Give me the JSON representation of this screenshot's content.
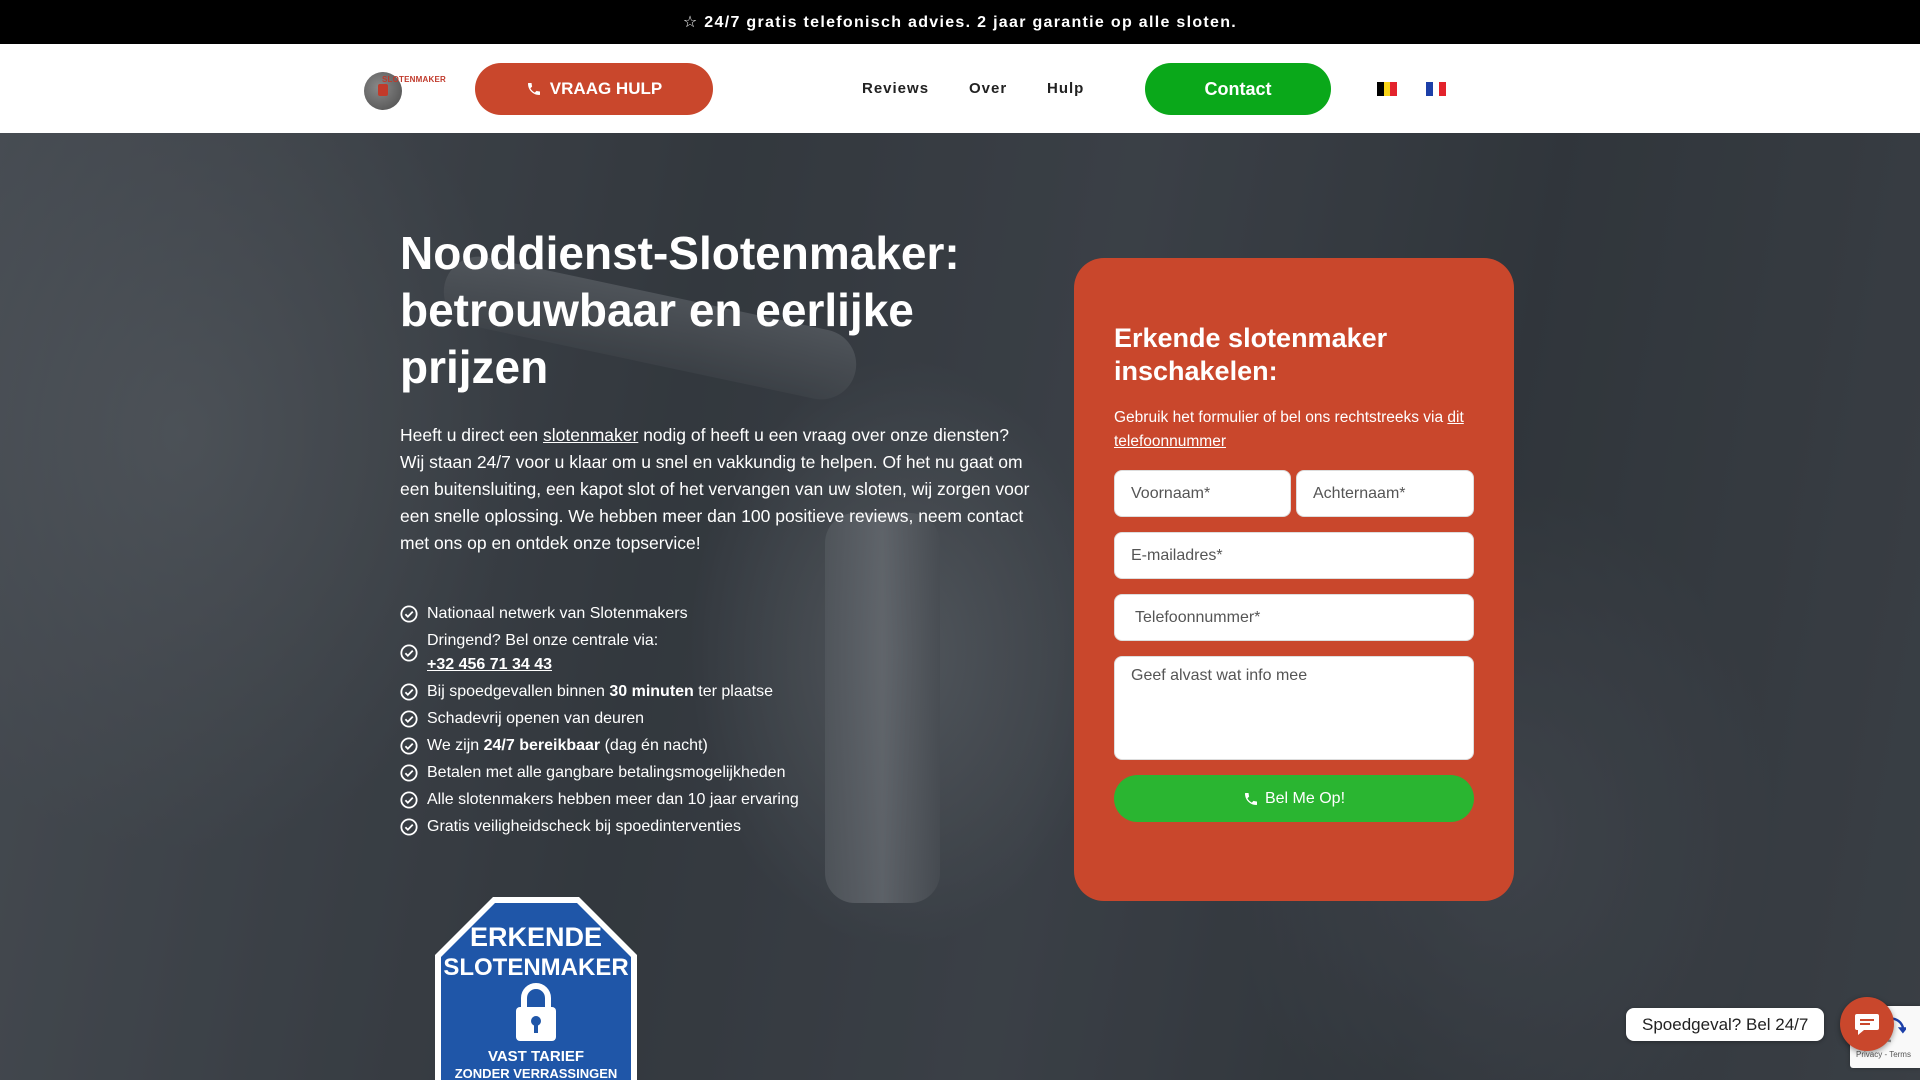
{
  "topbar": {
    "text": "☆ 24/7 gratis telefonisch advies. 2 jaar garantie op alle sloten."
  },
  "header": {
    "logo_text": "SLOTENMAKER",
    "help_button": "VRAAG HULP",
    "nav": [
      "Reviews",
      "Over",
      "Hulp"
    ],
    "contact_button": "Contact",
    "languages": [
      "nl-be-flag-icon",
      "fr-flag-icon"
    ]
  },
  "hero": {
    "title": "Nooddienst-Slotenmaker: betrouwbaar en eerlijke prijzen",
    "intro_before": "Heeft u direct een ",
    "intro_link": "slotenmaker",
    "intro_after": " nodig of heeft u een vraag over onze diensten? Wij staan 24/7 voor u klaar om u snel en vakkundig te helpen. Of het nu gaat om een buitensluiting, een kapot slot of het vervangen van uw sloten, wij zorgen voor een snelle oplossing. We hebben meer dan 100 positieve reviews, neem contact met ons op en ontdek onze topservice!",
    "features": {
      "f1": "Nationaal netwerk van Slotenmakers",
      "f2_text": "Dringend? Bel onze centrale via:",
      "f2_phone": "+32 456 71 34 43",
      "f3_pre": "Bij spoedgevallen binnen ",
      "f3_bold": "30 minuten",
      "f3_post": " ter plaatse",
      "f4": "Schadevrij openen van deuren",
      "f5_pre": "We zijn ",
      "f5_bold": "24/7 bereikbaar",
      "f5_post": " (dag én nacht)",
      "f6": "Betalen met alle gangbare betalingsmogelijkheden",
      "f7": "Alle slotenmakers hebben meer dan 10 jaar ervaring",
      "f8": "Gratis veiligheidscheck bij spoedinterventies"
    },
    "badge": {
      "line1": "ERKENDE",
      "line2": "SLOTENMAKER",
      "line3": "VAST TARIEF",
      "line4": "ZONDER VERRASSINGEN"
    }
  },
  "form": {
    "title": "Erkende slotenmaker inschakelen:",
    "subtitle": "Gebruik het formulier of bel ons rechtstreeks via ",
    "subtitle_link": "dit telefoonnummer",
    "firstname_placeholder": "Voornaam*",
    "lastname_placeholder": "Achternaam*",
    "email_placeholder": "E-mailadres*",
    "phone_placeholder": "Telefoonnummer*",
    "message_placeholder": "Geef alvast wat info mee",
    "submit": "Bel Me Op!"
  },
  "chat": {
    "label": "Spoedgeval? Bel 24/7"
  },
  "recaptcha": {
    "terms": "Privacy - Terms"
  },
  "colors": {
    "brand_red": "#c9472c",
    "green": "#0aa81a",
    "form_green": "#2ab531",
    "badge_blue": "#1f56a8"
  }
}
